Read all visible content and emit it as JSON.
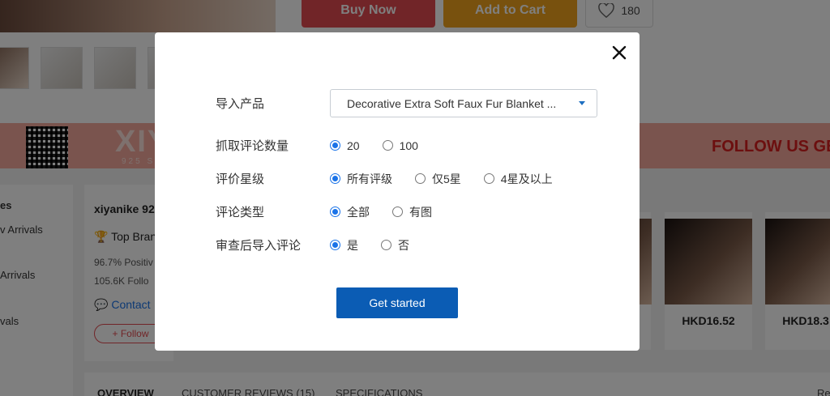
{
  "background": {
    "buy_now": "Buy Now",
    "add_to_cart": "Add to Cart",
    "like_count": "180",
    "banner_brand": "XIY",
    "banner_brand_sub": "925 S",
    "banner_follow": "FOLLOW US GET",
    "left_nav": [
      "es",
      "v Arrivals",
      "Arrivals",
      "vals"
    ],
    "store": {
      "name": "xiyanike 92",
      "badge": "Top Bran",
      "positive": "96.7% Positiv",
      "followers": "105.6K Follo",
      "contact": "Contact",
      "follow": "+ Follow"
    },
    "products": [
      {
        "price": "HKD16.52"
      },
      {
        "price": "HKD18.3"
      }
    ],
    "tabs": [
      "OVERVIEW",
      "CUSTOMER REVIEWS (15)",
      "SPECIFICATIONS",
      "Re"
    ]
  },
  "modal": {
    "rows": {
      "product": {
        "label": "导入产品",
        "value": "Decorative Extra Soft Faux Fur Blanket ..."
      },
      "count": {
        "label": "抓取评论数量",
        "options": [
          "20",
          "100"
        ],
        "selected": "20"
      },
      "stars": {
        "label": "评价星级",
        "options": [
          "所有评级",
          "仅5星",
          "4星及以上"
        ],
        "selected": "所有评级"
      },
      "type": {
        "label": "评论类型",
        "options": [
          "全部",
          "有图"
        ],
        "selected": "全部"
      },
      "review": {
        "label": "审查后导入评论",
        "options": [
          "是",
          "否"
        ],
        "selected": "是"
      }
    },
    "submit": "Get started"
  },
  "colors": {
    "primary": "#0b5cb4",
    "radio_active": "#1a73e8",
    "buy_now": "#e34b50",
    "add_to_cart": "#f0a21c",
    "banner": "#f4a99d"
  }
}
